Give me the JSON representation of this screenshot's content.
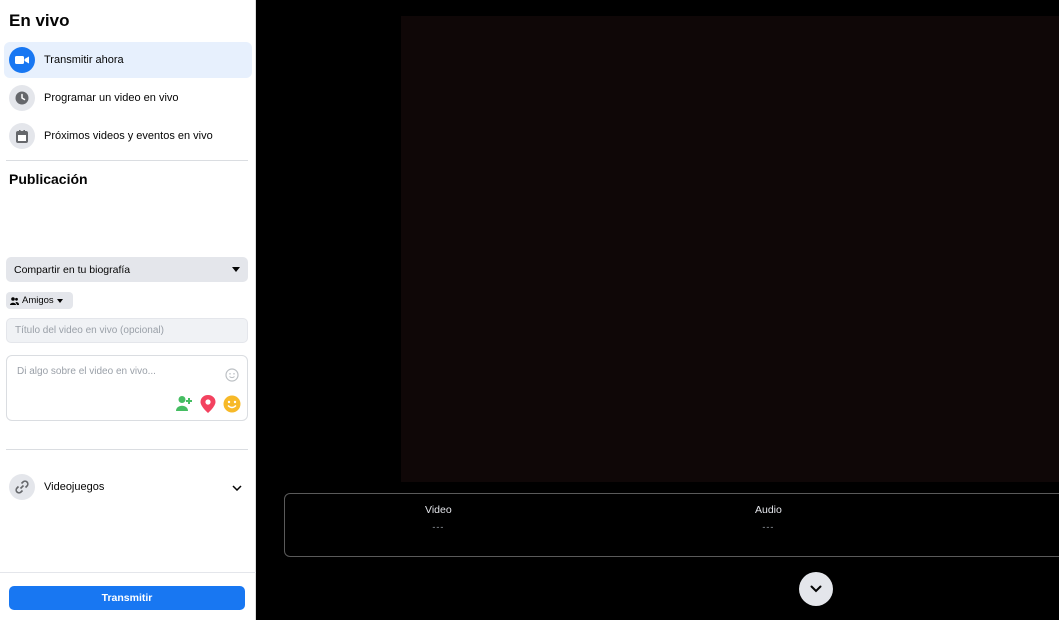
{
  "sidebar": {
    "title": "En vivo",
    "nav": [
      {
        "label": "Transmitir ahora",
        "icon": "video-camera-icon",
        "active": true
      },
      {
        "label": "Programar un video en vivo",
        "icon": "clock-icon",
        "active": false
      },
      {
        "label": "Próximos videos y eventos en vivo",
        "icon": "calendar-icon",
        "active": false
      }
    ],
    "publication": {
      "title": "Publicación",
      "share_select": "Compartir en tu biografía",
      "audience": "Amigos",
      "title_placeholder": "Título del video en vivo (opcional)",
      "description_placeholder": "Di algo sobre el video en vivo..."
    },
    "games": {
      "label": "Videojuegos",
      "icon": "link-icon"
    },
    "go_live_button": "Transmitir"
  },
  "preview": {
    "stats": {
      "video_label": "Video",
      "video_value": "---",
      "audio_label": "Audio",
      "audio_value": "---"
    }
  },
  "colors": {
    "accent": "#1877f2",
    "active_bg": "#e7f0fd",
    "tag_green": "#45bd62",
    "location_red": "#f3425f",
    "feeling_yellow": "#f7b928"
  }
}
